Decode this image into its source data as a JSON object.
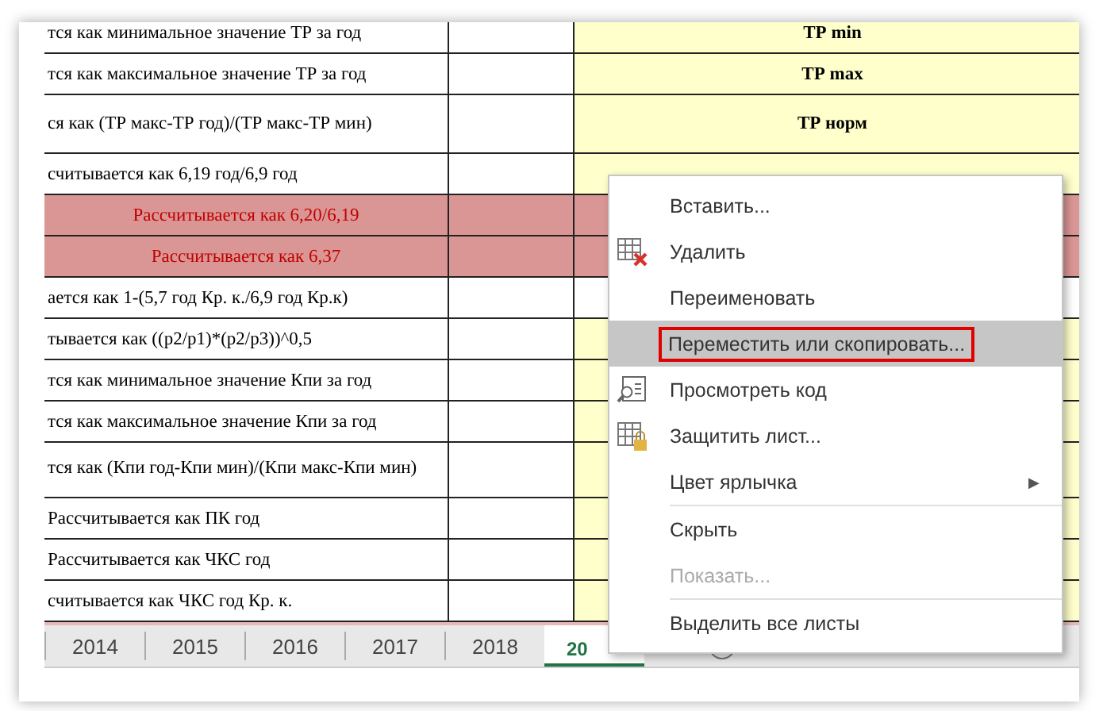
{
  "sheet": {
    "rows": [
      {
        "description": "тся как минимальное значение ТР за год",
        "kind": "plain",
        "marked": true,
        "value": "ТР min"
      },
      {
        "description": "тся как максимальное значение ТР за год",
        "kind": "plain",
        "marked": true,
        "value": "ТР max"
      },
      {
        "description": "ся как (ТР макс-ТР год)/(ТР макс-ТР мин)",
        "kind": "plain",
        "marked": true,
        "value": "ТР норм"
      },
      {
        "description": "считывается как 6,19 год/6,9 год",
        "kind": "plain",
        "marked": true
      },
      {
        "description": "Рассчитывается как 6,20/6,19",
        "kind": "alert"
      },
      {
        "description": "Рассчитывается как 6,37",
        "kind": "alert"
      },
      {
        "description": "ается как 1-(5,7 год Кр. к./6,9 год Кр.к)",
        "kind": "plain",
        "marked": false
      },
      {
        "description": "тывается как ((p2/p1)*(p2/p3))^0,5",
        "kind": "plain",
        "marked": true
      },
      {
        "description": "тся как минимальное значение Кпи за год",
        "kind": "plain",
        "marked": true
      },
      {
        "description": "тся как максимальное значение Кпи за год",
        "kind": "plain",
        "marked": true
      },
      {
        "description": "тся как (Кпи год-Кпи мин)/(Кпи макс-Кпи мин)",
        "kind": "plain",
        "marked": true
      },
      {
        "description": "Рассчитывается как ПК год",
        "kind": "plain",
        "marked": true
      },
      {
        "description": "Рассчитывается как ЧКС год",
        "kind": "plain",
        "marked": true
      },
      {
        "description": "считывается как ЧКС год Кр. к.",
        "kind": "plain",
        "marked": true
      }
    ]
  },
  "sheet_tabs": [
    {
      "label": "2014",
      "selected": false
    },
    {
      "label": "2015",
      "selected": false
    },
    {
      "label": "2016",
      "selected": false
    },
    {
      "label": "2017",
      "selected": false
    },
    {
      "label": "2018",
      "selected": false
    },
    {
      "label": "20",
      "selected": true
    }
  ],
  "context_menu": {
    "items": [
      {
        "kind": "plain",
        "label": "Вставить...",
        "disabled": false,
        "selected": false
      },
      {
        "kind": "delete",
        "label": "Удалить",
        "disabled": false,
        "selected": false
      },
      {
        "kind": "plain",
        "label": "Переименовать",
        "disabled": false,
        "selected": false
      },
      {
        "kind": "plain",
        "label": "Переместить или скопировать...",
        "disabled": false,
        "selected": true
      },
      {
        "kind": "code",
        "label": "Просмотреть код",
        "disabled": false,
        "selected": false
      },
      {
        "kind": "protect",
        "label": "Защитить лист...",
        "disabled": false,
        "selected": false
      },
      {
        "kind": "plain",
        "label": "Цвет ярлычка",
        "disabled": false,
        "selected": false,
        "arrow": "▶"
      },
      {
        "kind": "separator"
      },
      {
        "kind": "plain",
        "label": "Скрыть",
        "disabled": false,
        "selected": false
      },
      {
        "kind": "plain",
        "label": "Показать...",
        "disabled": true,
        "selected": false
      },
      {
        "kind": "separator"
      },
      {
        "kind": "plain",
        "label": "Выделить все листы",
        "disabled": false,
        "selected": false
      }
    ]
  }
}
